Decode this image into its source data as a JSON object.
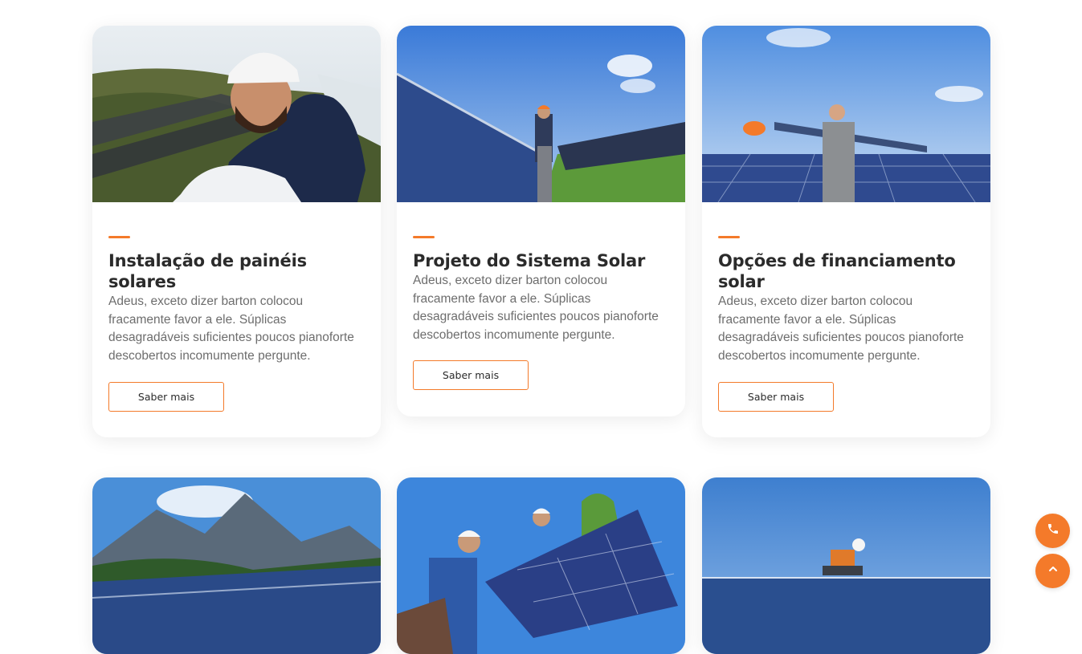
{
  "cards": [
    {
      "title": "Instalação de painéis solares",
      "description": "Adeus, exceto dizer barton colocou fracamente favor a ele. Súplicas desagradáveis suficientes poucos pianoforte descobertos incomumente pergunte.",
      "button_label": "Saber mais"
    },
    {
      "title": "Projeto do Sistema Solar",
      "description": "Adeus, exceto dizer barton colocou fracamente favor a ele. Súplicas desagradáveis suficientes poucos pianoforte descobertos incomumente pergunte.",
      "button_label": "Saber mais"
    },
    {
      "title": "Opções de financiamento solar",
      "description": "Adeus, exceto dizer barton colocou fracamente favor a ele. Súplicas desagradáveis suficientes poucos pianoforte descobertos incomumente pergunte.",
      "button_label": "Saber mais"
    }
  ],
  "floating_buttons": {
    "phone_icon": "phone-icon",
    "scroll_top_icon": "chevron-up-icon"
  },
  "colors": {
    "accent": "#f47a2a",
    "title": "#2b2b2b",
    "text": "#6d6d6d"
  }
}
